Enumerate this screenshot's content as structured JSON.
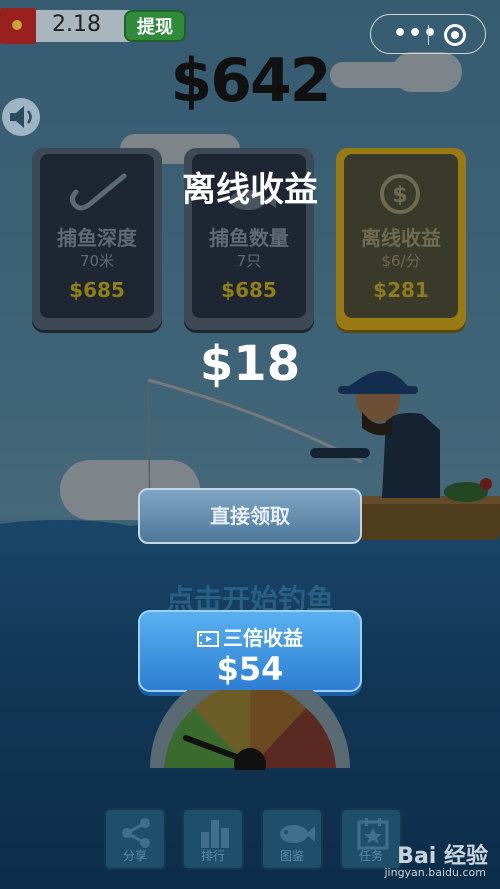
{
  "topbar": {
    "balance": "2.18",
    "withdraw_label": "提现"
  },
  "money_total": "$642",
  "popup": {
    "title": "离线收益",
    "reward": "$18",
    "collect_label": "直接领取",
    "triple_label": "三倍收益",
    "triple_amount": "$54"
  },
  "upgrades": [
    {
      "name": "捕鱼深度",
      "detail": "70米",
      "price": "$685",
      "icon": "hook-icon"
    },
    {
      "name": "捕鱼数量",
      "detail": "7只",
      "price": "$685",
      "icon": "fish-count-icon"
    },
    {
      "name": "离线收益",
      "detail": "$6/分",
      "price": "$281",
      "icon": "dollar-coin-icon"
    }
  ],
  "tap_hint": "点击开始钓鱼",
  "bottom_nav": [
    {
      "label": "分享",
      "icon": "share-icon"
    },
    {
      "label": "排行",
      "icon": "leaderboard-icon"
    },
    {
      "label": "图鉴",
      "icon": "fish-icon"
    },
    {
      "label": "任务",
      "icon": "calendar-icon"
    }
  ],
  "watermark": {
    "main": "Bai 经验",
    "sub": "jingyan.baidu.com"
  },
  "colors": {
    "gold": "#9a7a12",
    "triple_btn": "#2d7ed4",
    "withdraw_btn": "#2f8b3a"
  }
}
